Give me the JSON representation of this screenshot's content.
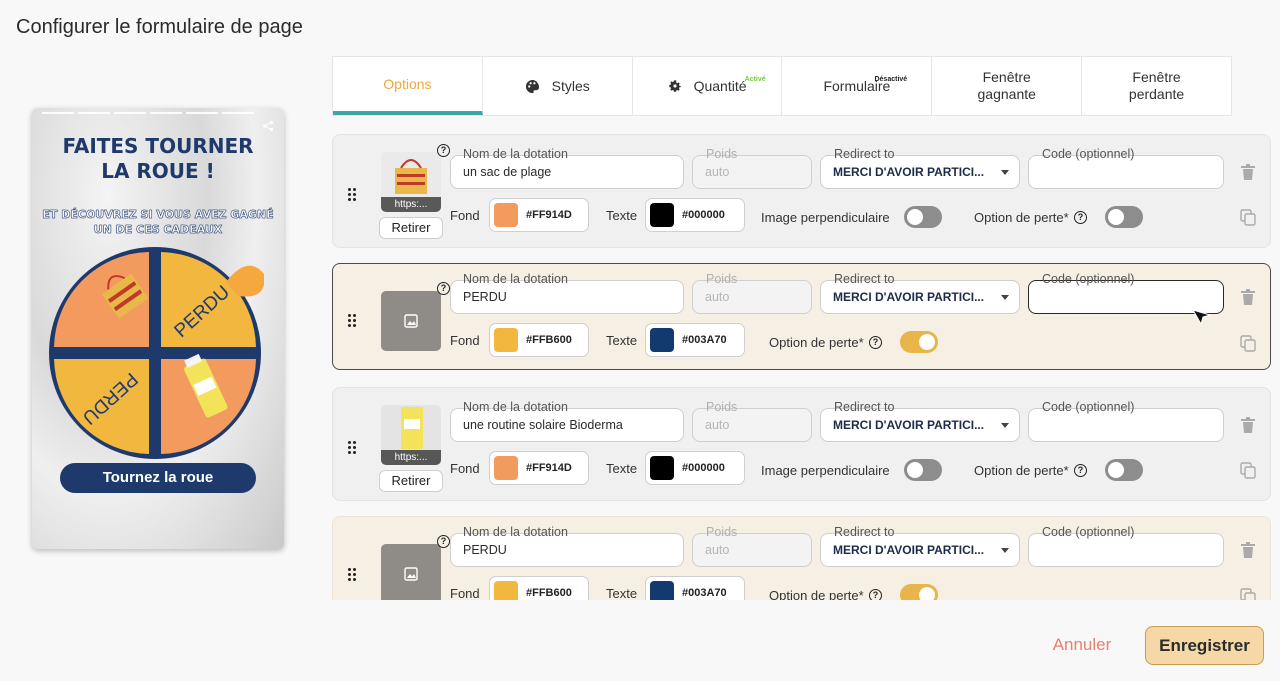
{
  "page": {
    "title": "Configurer le formulaire de page"
  },
  "preview": {
    "title_line1": "FAITES TOURNER",
    "title_line2": "LA ROUE !",
    "subtitle": "ET DÉCOUVREZ SI VOUS AVEZ GAGNÉ UN DE CES CADEAUX",
    "wheel_segments": [
      {
        "label": "",
        "color": "#FF914D"
      },
      {
        "label": "PERDU",
        "color": "#FFB600"
      },
      {
        "label": "",
        "color": "#FF914D"
      },
      {
        "label": "PERDU",
        "color": "#FFB600"
      }
    ],
    "button": "Tournez la roue"
  },
  "tabs": [
    {
      "label": "Options",
      "icon": "",
      "badge": "",
      "active": true
    },
    {
      "label": "Styles",
      "icon": "palette-icon",
      "badge": "",
      "active": false
    },
    {
      "label": "Quantité",
      "icon": "gear-icon",
      "badge": "Activé",
      "badge_color": "#7ac943",
      "active": false
    },
    {
      "label": "Formulaire",
      "icon": "",
      "badge": "Désactivé",
      "badge_color": "#222222",
      "active": false
    },
    {
      "label": "Fenêtre gagnante",
      "icon": "",
      "badge": "",
      "active": false
    },
    {
      "label": "Fenêtre perdante",
      "icon": "",
      "badge": "",
      "active": false
    }
  ],
  "labels": {
    "name": "Nom de la dotation",
    "weight": "Poids",
    "redirect": "Redirect to",
    "code": "Code (optionnel)",
    "bg": "Fond",
    "text": "Texte",
    "perp": "Image perpendiculaire",
    "lossopt": "Option de perte*",
    "remove": "Retirer",
    "thumb_caption": "https:...",
    "weight_placeholder": "auto",
    "help_glyph": "?"
  },
  "rows": [
    {
      "name": "un sac de plage",
      "redirect": "MERCI D'AVOIR PARTICI...",
      "code": "",
      "bg": "#FF914D",
      "text": "#000000",
      "perp": false,
      "loss": false
    },
    {
      "name": "PERDU",
      "redirect": "MERCI D'AVOIR PARTICI...",
      "code": "",
      "bg": "#FFB600",
      "text": "#003A70",
      "loss": true
    },
    {
      "name": "une routine solaire Bioderma",
      "redirect": "MERCI D'AVOIR PARTICI...",
      "code": "",
      "bg": "#FF914D",
      "text": "#000000",
      "perp": false,
      "loss": false
    },
    {
      "name": "PERDU",
      "redirect": "MERCI D'AVOIR PARTICI...",
      "code": "",
      "bg": "#FFB600",
      "text": "#003A70",
      "loss": true
    }
  ],
  "swatches": {
    "orange": "#F39A5E",
    "yellow": "#F2B73E",
    "black": "#000000",
    "navy": "#133A6E"
  },
  "footer": {
    "cancel": "Annuler",
    "save": "Enregistrer"
  }
}
